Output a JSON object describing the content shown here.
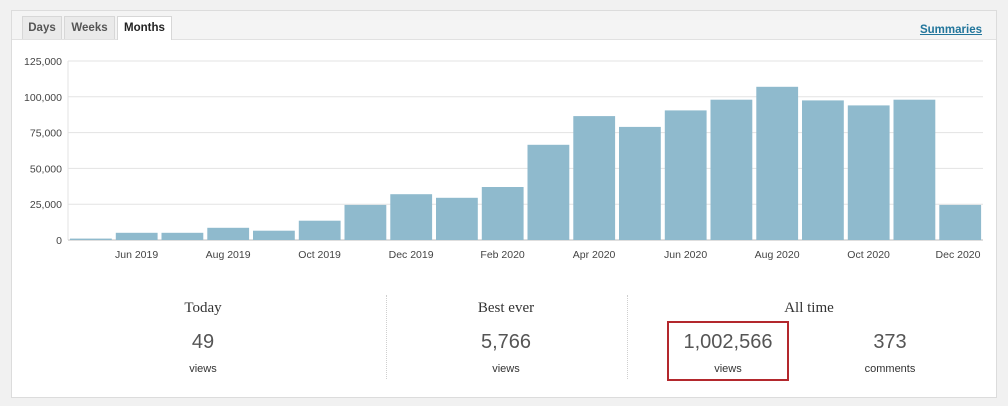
{
  "tabs": [
    {
      "label": "Days",
      "active": false
    },
    {
      "label": "Weeks",
      "active": false
    },
    {
      "label": "Months",
      "active": true
    }
  ],
  "summaries_label": "Summaries",
  "chart_data": {
    "type": "bar",
    "categories": [
      "May 2019",
      "Jun 2019",
      "Jul 2019",
      "Aug 2019",
      "Sep 2019",
      "Oct 2019",
      "Nov 2019",
      "Dec 2019",
      "Jan 2020",
      "Feb 2020",
      "Mar 2020",
      "Apr 2020",
      "May 2020",
      "Jun 2020",
      "Jul 2020",
      "Aug 2020",
      "Sep 2020",
      "Oct 2020",
      "Nov 2020",
      "Dec 2020"
    ],
    "values": [
      1000,
      5000,
      5000,
      8500,
      6500,
      13500,
      24500,
      32000,
      29500,
      37000,
      66500,
      86500,
      79000,
      90500,
      98000,
      107000,
      97500,
      94000,
      98000,
      24500
    ],
    "ylim": [
      0,
      125000
    ],
    "yticks": [
      {
        "value": 0,
        "label": "0"
      },
      {
        "value": 25000,
        "label": "25,000"
      },
      {
        "value": 50000,
        "label": "50,000"
      },
      {
        "value": 75000,
        "label": "75,000"
      },
      {
        "value": 100000,
        "label": "100,000"
      },
      {
        "value": 125000,
        "label": "125,000"
      }
    ],
    "xticks": [
      {
        "index": 1,
        "label": "Jun 2019"
      },
      {
        "index": 3,
        "label": "Aug 2019"
      },
      {
        "index": 5,
        "label": "Oct 2019"
      },
      {
        "index": 7,
        "label": "Dec 2019"
      },
      {
        "index": 9,
        "label": "Feb 2020"
      },
      {
        "index": 11,
        "label": "Apr 2020"
      },
      {
        "index": 13,
        "label": "Jun 2020"
      },
      {
        "index": 15,
        "label": "Aug 2020"
      },
      {
        "index": 17,
        "label": "Oct 2020"
      },
      {
        "index": 19,
        "label": "Dec 2020"
      }
    ],
    "grid": true,
    "bar_color": "#8fbacd"
  },
  "stats": {
    "today": {
      "title": "Today",
      "value": "49",
      "unit": "views"
    },
    "best": {
      "title": "Best ever",
      "value": "5,766",
      "unit": "views"
    },
    "alltime": {
      "title": "All time",
      "views_value": "1,002,566",
      "views_unit": "views",
      "comments_value": "373",
      "comments_unit": "comments"
    }
  },
  "highlight_color": "#b3282d"
}
